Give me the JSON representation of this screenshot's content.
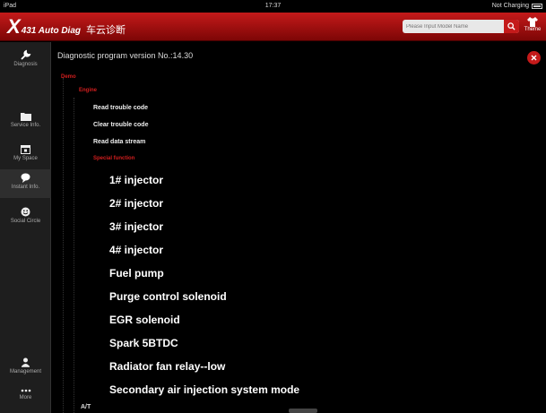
{
  "status": {
    "device": "iPad",
    "time": "17:37",
    "charging": "Not Charging"
  },
  "header": {
    "logo_x": "X",
    "brand": "431 Auto Diag",
    "brand_cn": "车云诊断",
    "search_placeholder": "Please Input Model Name",
    "theme_label": "Theme",
    "accent": "#c41a1a"
  },
  "sidebar": {
    "items": [
      {
        "label": "Diagnosis",
        "icon": "wrench-icon"
      },
      {
        "label": "Service Info.",
        "icon": "folder-icon"
      },
      {
        "label": "My Space",
        "icon": "calendar-icon"
      },
      {
        "label": "Instant Info.",
        "icon": "chat-bubble-icon"
      },
      {
        "label": "Social Circle",
        "icon": "smiley-icon"
      },
      {
        "label": "Management",
        "icon": "person-icon"
      },
      {
        "label": "More",
        "icon": "more-dots-icon"
      }
    ]
  },
  "main": {
    "version": "Diagnostic program version No.:14.30",
    "tree": {
      "root": "Demo",
      "system": "Engine",
      "menu": [
        "Read trouble code",
        "Clear trouble code",
        "Read data stream"
      ],
      "special": "Special function",
      "functions": [
        "1# injector",
        "2# injector",
        "3# injector",
        "4# injector",
        "Fuel pump",
        "Purge control solenoid",
        "EGR solenoid",
        "Spark 5BTDC",
        "Radiator fan relay--low",
        "Secondary air injection system mode"
      ],
      "next": "A/T"
    }
  }
}
